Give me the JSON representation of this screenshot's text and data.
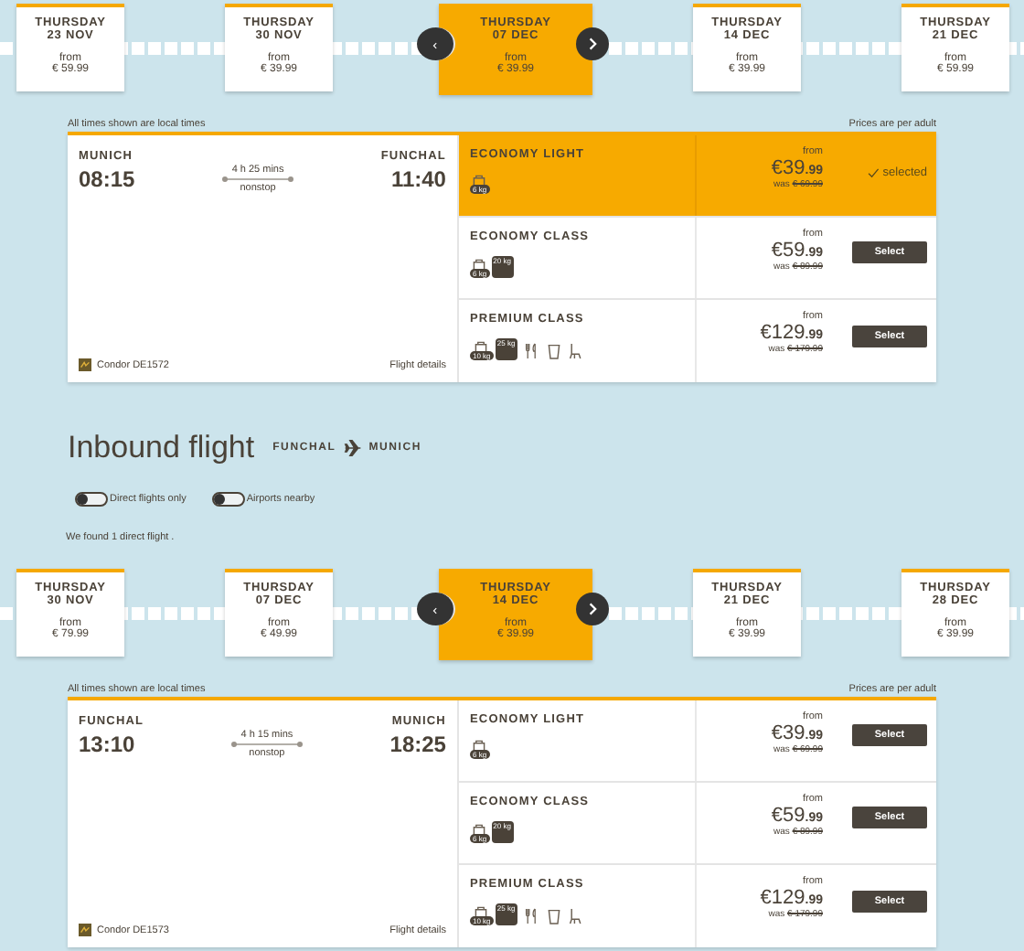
{
  "outbound": {
    "dates": [
      {
        "day": "THURSDAY",
        "date": "23 NOV",
        "from": "from",
        "price": "€ 59.99",
        "selected": false
      },
      {
        "day": "THURSDAY",
        "date": "30 NOV",
        "from": "from",
        "price": "€ 39.99",
        "selected": false
      },
      {
        "day": "THURSDAY",
        "date": "07 DEC",
        "from": "from",
        "price": "€ 39.99",
        "selected": true
      },
      {
        "day": "THURSDAY",
        "date": "14 DEC",
        "from": "from",
        "price": "€ 39.99",
        "selected": false
      },
      {
        "day": "THURSDAY",
        "date": "21 DEC",
        "from": "from",
        "price": "€ 59.99",
        "selected": false
      }
    ],
    "times_note": "All times shown are local times",
    "prices_note": "Prices are per adult",
    "flight": {
      "origin": "MUNICH",
      "depart": "08:15",
      "destination": "FUNCHAL",
      "arrive": "11:40",
      "duration": "4 h 25 mins",
      "stops": "nonstop",
      "airline": "Condor DE1572",
      "details": "Flight details"
    },
    "fares": [
      {
        "name": "ECONOMY LIGHT",
        "selected": true,
        "from": "from",
        "price": "€39",
        "cents": ".99",
        "was_label": "was",
        "was": "€ 69.99",
        "action": "selected",
        "baggage": [
          {
            "kind": "hand",
            "label": "6 kg"
          }
        ]
      },
      {
        "name": "ECONOMY CLASS",
        "selected": false,
        "from": "from",
        "price": "€59",
        "cents": ".99",
        "was_label": "was",
        "was": "€ 89.99",
        "action": "Select",
        "baggage": [
          {
            "kind": "hand",
            "label": "6 kg"
          },
          {
            "kind": "hold",
            "label": "20 kg"
          }
        ]
      },
      {
        "name": "PREMIUM CLASS",
        "selected": false,
        "from": "from",
        "price": "€129",
        "cents": ".99",
        "was_label": "was",
        "was": "€ 179.99",
        "action": "Select",
        "baggage": [
          {
            "kind": "hand",
            "label": "10 kg"
          },
          {
            "kind": "hold",
            "label": "25 kg"
          }
        ],
        "amenities": [
          {
            "kind": "meal"
          },
          {
            "kind": "drink"
          },
          {
            "kind": "seat"
          }
        ]
      }
    ]
  },
  "inbound": {
    "title": "Inbound flight",
    "route_from": "FUNCHAL",
    "route_to": "MUNICH",
    "filters": [
      {
        "label": "Direct flights only",
        "on": false
      },
      {
        "label": "Airports nearby",
        "on": false
      }
    ],
    "result_text": "We found 1 direct flight .",
    "dates": [
      {
        "day": "THURSDAY",
        "date": "30 NOV",
        "from": "from",
        "price": "€ 79.99",
        "selected": false
      },
      {
        "day": "THURSDAY",
        "date": "07 DEC",
        "from": "from",
        "price": "€ 49.99",
        "selected": false
      },
      {
        "day": "THURSDAY",
        "date": "14 DEC",
        "from": "from",
        "price": "€ 39.99",
        "selected": true
      },
      {
        "day": "THURSDAY",
        "date": "21 DEC",
        "from": "from",
        "price": "€ 39.99",
        "selected": false
      },
      {
        "day": "THURSDAY",
        "date": "28 DEC",
        "from": "from",
        "price": "€ 39.99",
        "selected": false
      }
    ],
    "times_note": "All times shown are local times",
    "prices_note": "Prices are per adult",
    "flight": {
      "origin": "FUNCHAL",
      "depart": "13:10",
      "destination": "MUNICH",
      "arrive": "18:25",
      "duration": "4 h 15 mins",
      "stops": "nonstop",
      "airline": "Condor DE1573",
      "details": "Flight details"
    },
    "fares": [
      {
        "name": "ECONOMY LIGHT",
        "selected": false,
        "from": "from",
        "price": "€39",
        "cents": ".99",
        "was_label": "was",
        "was": "€ 69.99",
        "action": "Select",
        "baggage": [
          {
            "kind": "hand",
            "label": "6 kg"
          }
        ]
      },
      {
        "name": "ECONOMY CLASS",
        "selected": false,
        "from": "from",
        "price": "€59",
        "cents": ".99",
        "was_label": "was",
        "was": "€ 89.99",
        "action": "Select",
        "baggage": [
          {
            "kind": "hand",
            "label": "6 kg"
          },
          {
            "kind": "hold",
            "label": "20 kg"
          }
        ]
      },
      {
        "name": "PREMIUM CLASS",
        "selected": false,
        "from": "from",
        "price": "€129",
        "cents": ".99",
        "was_label": "was",
        "was": "€ 179.99",
        "action": "Select",
        "baggage": [
          {
            "kind": "hand",
            "label": "10 kg"
          },
          {
            "kind": "hold",
            "label": "25 kg"
          }
        ],
        "amenities": [
          {
            "kind": "meal"
          },
          {
            "kind": "drink"
          },
          {
            "kind": "seat"
          }
        ]
      }
    ]
  }
}
